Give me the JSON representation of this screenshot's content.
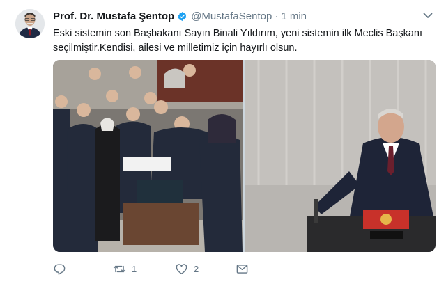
{
  "tweet": {
    "author_name": "Prof. Dr. Mustafa Şentop",
    "handle": "@MustafaSentop",
    "separator": "·",
    "time": "1 min",
    "text": "Eski sistemin son Başbakanı Sayın Binali Yıldırım, yeni sistemin ilk Meclis Başkanı seçilmiştir.Kendisi, ailesi ve milletimiz için hayırlı olsun.",
    "media": [
      {
        "icon": "photo-parliament-vote"
      },
      {
        "icon": "photo-speaker-podium"
      }
    ],
    "actions": {
      "reply": {
        "icon": "reply-icon",
        "count": ""
      },
      "retweet": {
        "icon": "retweet-icon",
        "count": "1"
      },
      "like": {
        "icon": "heart-icon",
        "count": "2"
      },
      "dm": {
        "icon": "envelope-icon",
        "count": ""
      }
    }
  },
  "colors": {
    "verified": "#1da1f2",
    "text_primary": "#14171a",
    "text_secondary": "#657786"
  }
}
